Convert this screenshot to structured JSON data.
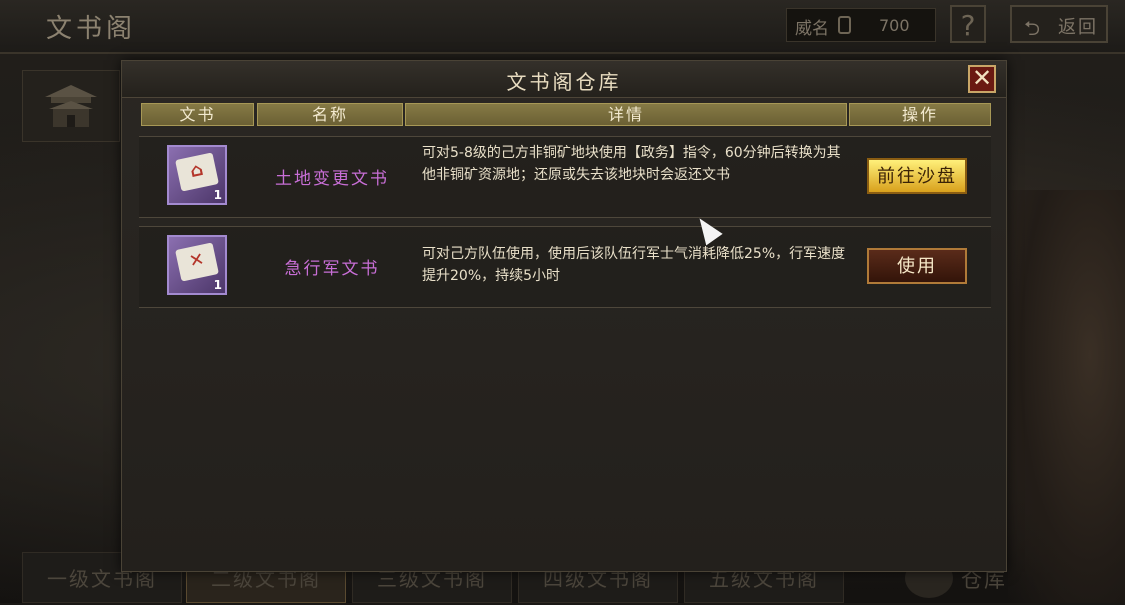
{
  "header": {
    "page_title": "文书阁",
    "fame_label": "威名",
    "fame_value": "700",
    "help_label": "?",
    "back_label": "返回"
  },
  "modal": {
    "title": "文书阁仓库",
    "close_label": "✕",
    "columns": [
      "文书",
      "名称",
      "详情",
      "操作"
    ],
    "items": [
      {
        "name": "土地变更文书",
        "count": "1",
        "detail": "可对5-8级的己方非铜矿地块使用【政务】指令，60分钟后转换为其他非铜矿资源地；还原或失去该地块时会返还文书",
        "action": "前往沙盘"
      },
      {
        "name": "急行军文书",
        "count": "1",
        "detail": "可对己方队伍使用，使用后该队伍行军士气消耗降低25%，行军速度提升20%，持续5小时",
        "action": "使用"
      }
    ]
  },
  "bottom_tabs": {
    "tabs": [
      "一级文书阁",
      "二级文书阁",
      "三级文书阁",
      "四级文书阁",
      "五级文书阁"
    ],
    "warehouse_label": "仓库"
  },
  "colors": {
    "accent_gold": "#d9a11d",
    "item_name_purple": "#c86ed6",
    "item_frame_purple": "#a38ad0"
  }
}
